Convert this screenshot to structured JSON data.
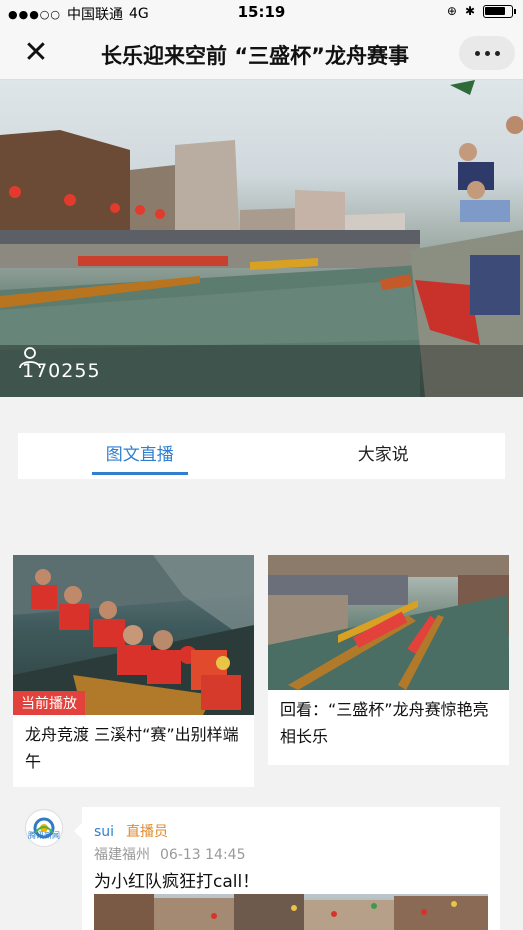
{
  "status_bar": {
    "carrier": "中国联通",
    "network": "4G",
    "time": "15:19",
    "battery_level": 0.85
  },
  "nav": {
    "title": "长乐迎来空前 “三盛杯”龙舟赛事",
    "close_icon": "close-icon",
    "more_icon": "more-icon"
  },
  "hero": {
    "viewer_count": "170255",
    "viewer_icon": "user-icon"
  },
  "tabs": [
    {
      "label": "图文直播",
      "active": true
    },
    {
      "label": "大家说",
      "active": false
    }
  ],
  "videos": [
    {
      "badge": "当前播放",
      "title": "龙舟竞渡 三溪村“赛”出别样端午"
    },
    {
      "title": "回看：“三盛杯”龙舟赛惊艳亮相长乐"
    }
  ],
  "comment": {
    "source_logo_text": "腾讯新闻",
    "author": "sui",
    "role": "直播员",
    "location": "福建福州",
    "time": "06-13 14:45",
    "text": "为小红队疯狂打call！"
  },
  "colors": {
    "accent": "#2f7fd0",
    "live_badge": "#e2423b",
    "role": "#e08a2c"
  }
}
